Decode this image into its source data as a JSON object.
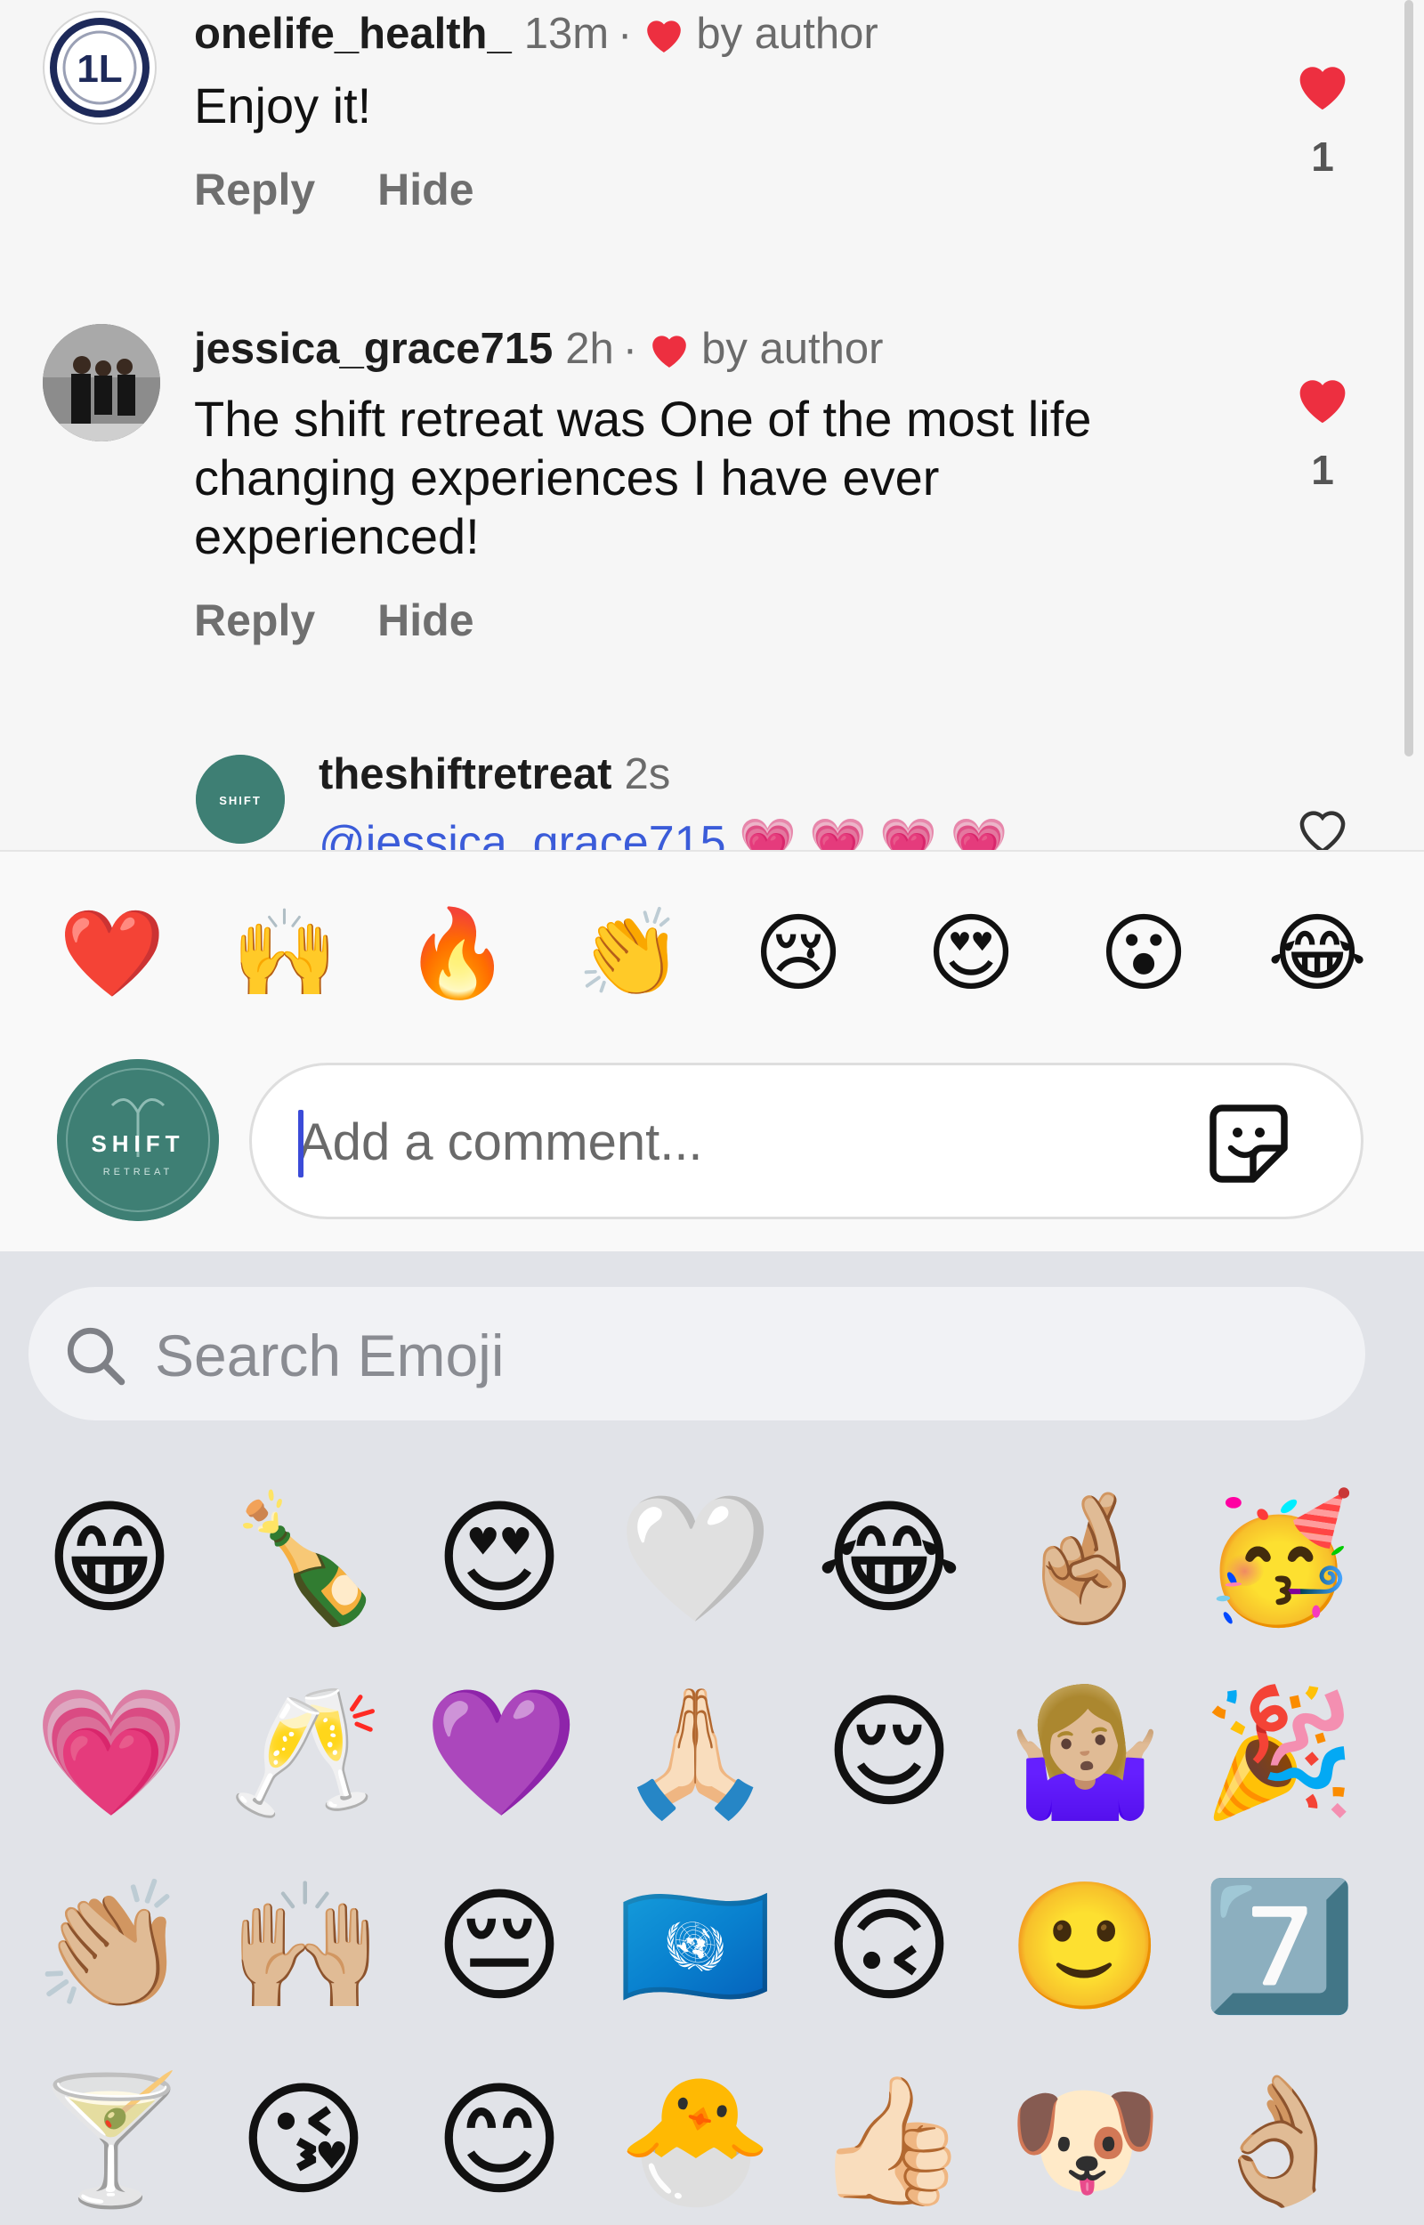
{
  "comments": [
    {
      "handle": "onelife_health_",
      "time": "13m",
      "dot": "·",
      "by_author": "by author",
      "text": "Enjoy it!",
      "reply": "Reply",
      "hide": "Hide",
      "likes": "1"
    },
    {
      "handle": "jessica_grace715",
      "time": "2h",
      "dot": "·",
      "by_author": "by author",
      "text": "The shift retreat was One of the most life changing experiences I have ever experienced!",
      "reply": "Reply",
      "hide": "Hide",
      "likes": "1"
    }
  ],
  "reply": {
    "handle": "theshiftretreat",
    "time": "2s",
    "mention": "@jessica_grace715",
    "hearts": "💗 💗 💗 💗"
  },
  "avatar_1l_text": "1L",
  "avatar_shift_text": "SHIFT",
  "avatar_shift_sub": "RETREAT",
  "quick_reactions": [
    "❤️",
    "🙌",
    "🔥",
    "👏",
    "😢",
    "😍",
    "😮",
    "😂"
  ],
  "composer": {
    "placeholder": "Add a comment..."
  },
  "emoji_search": {
    "placeholder": "Search Emoji"
  },
  "emoji_rows": [
    [
      "😁",
      "🍾",
      "😍",
      "🤍",
      "😂",
      "🤞🏼",
      "🥳"
    ],
    [
      "💗",
      "🥂",
      "💜",
      "🙏🏻",
      "😌",
      "🤷🏼‍♀️",
      "🎉"
    ],
    [
      "👏🏼",
      "🙌🏼",
      "😔",
      "🇺🇳",
      "🙃",
      "🙂",
      "7️⃣"
    ],
    [
      "🍸",
      "😘",
      "😊",
      "🐣",
      "👍🏻",
      "🐶",
      "👌🏼"
    ]
  ],
  "colors": {
    "like_red": "#ed2f40",
    "mention_blue": "#3b5cd9",
    "brand_teal": "#3e7f74"
  }
}
